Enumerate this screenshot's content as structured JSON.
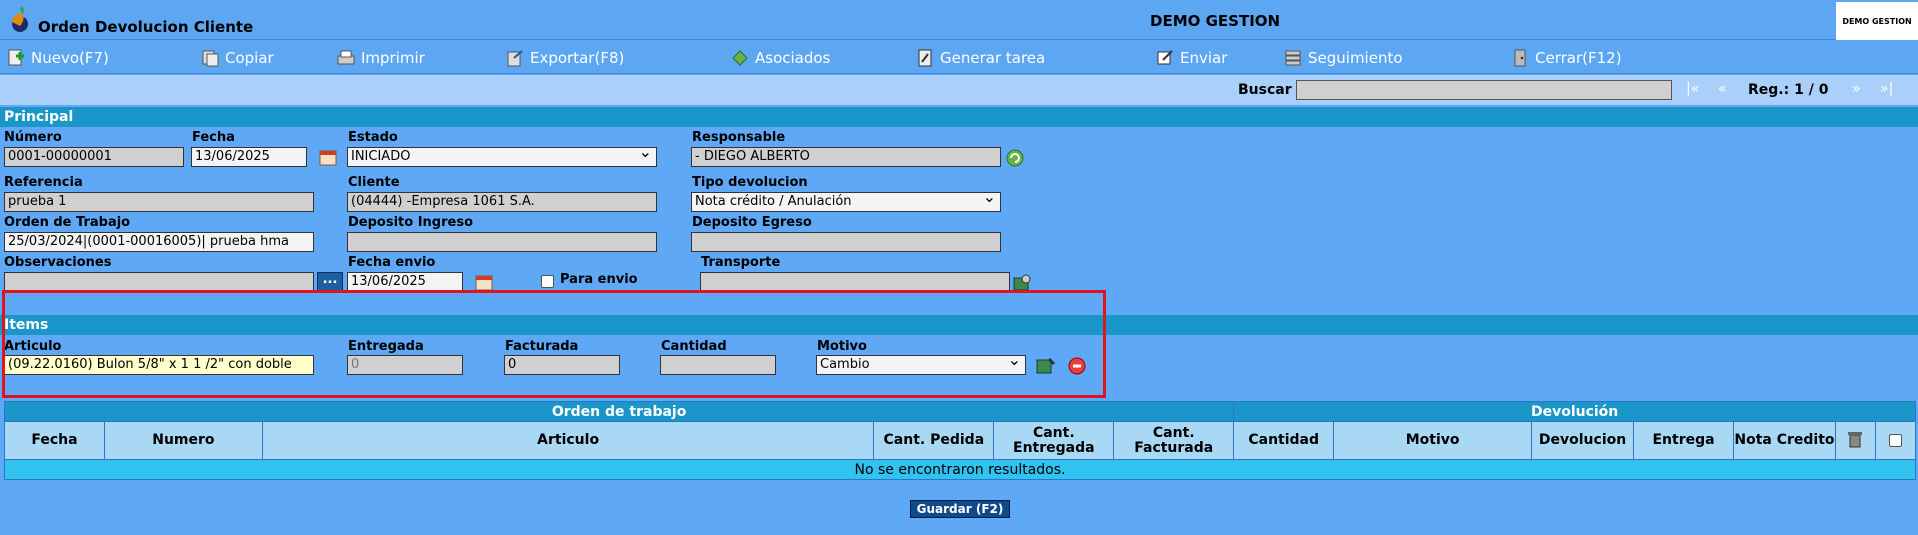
{
  "window": {
    "title": "Orden Devolucion Cliente",
    "center_title": "DEMO GESTION",
    "brand": "DEMO GESTION"
  },
  "toolbar": {
    "nuevo": "Nuevo(F7)",
    "copiar": "Copiar",
    "imprimir": "Imprimir",
    "exportar": "Exportar(F8)",
    "asociados": "Asociados",
    "generar": "Generar tarea",
    "enviar": "Enviar",
    "seguimiento": "Seguimiento",
    "cerrar": "Cerrar(F12)"
  },
  "search": {
    "label": "Buscar",
    "value": "",
    "first": "|«",
    "prev": "«",
    "reg": "Reg.: 1 / 0",
    "next": "»",
    "last": "»|"
  },
  "principal": {
    "header": "Principal",
    "numero_label": "Número",
    "numero": "0001-00000001",
    "fecha_label": "Fecha",
    "fecha": "13/06/2025",
    "estado_label": "Estado",
    "estado": "INICIADO",
    "responsable_label": "Responsable",
    "responsable": "- DIEGO ALBERTO",
    "referencia_label": "Referencia",
    "referencia": "prueba 1",
    "cliente_label": "Cliente",
    "cliente": "(04444) -Empresa 1061 S.A.",
    "tipo_label": "Tipo devolucion",
    "tipo": "Nota crédito / Anulación",
    "orden_label": "Orden de Trabajo",
    "orden": "25/03/2024|(0001-00016005)| prueba hma",
    "dep_ingreso_label": "Deposito Ingreso",
    "dep_ingreso": "",
    "dep_egreso_label": "Deposito Egreso",
    "dep_egreso": "",
    "obs_label": "Observaciones",
    "obs": "",
    "dots": "...",
    "fecha_envio_label": "Fecha envio",
    "fecha_envio": "13/06/2025",
    "para_envio_label": "Para envio",
    "transporte_label": "Transporte",
    "transporte": ""
  },
  "items": {
    "header": "Items",
    "articulo_label": "Articulo",
    "articulo": "(09.22.0160) Bulon 5/8\" x 1 1 /2\" con doble",
    "entregada_label": "Entregada",
    "entregada": "0",
    "facturada_label": "Facturada",
    "facturada": "0",
    "cantidad_label": "Cantidad",
    "cantidad": "",
    "motivo_label": "Motivo",
    "motivo": "Cambio"
  },
  "grid": {
    "group_ot": "Orden de trabajo",
    "group_dev": "Devolución",
    "cols": {
      "fecha": "Fecha",
      "numero": "Numero",
      "articulo": "Articulo",
      "cant_pedida": "Cant. Pedida",
      "cant_entregada": "Cant. Entregada",
      "cant_facturada": "Cant. Facturada",
      "cantidad": "Cantidad",
      "motivo": "Motivo",
      "devolucion": "Devolucion",
      "entrega": "Entrega",
      "nota_credito": "Nota Credito"
    },
    "empty": "No se encontraron resultados."
  },
  "save_label": "Guardar (F2)",
  "colors": {
    "background": "#5fa8f6",
    "header": "#1a96c8",
    "highlight": "#e0141e"
  }
}
